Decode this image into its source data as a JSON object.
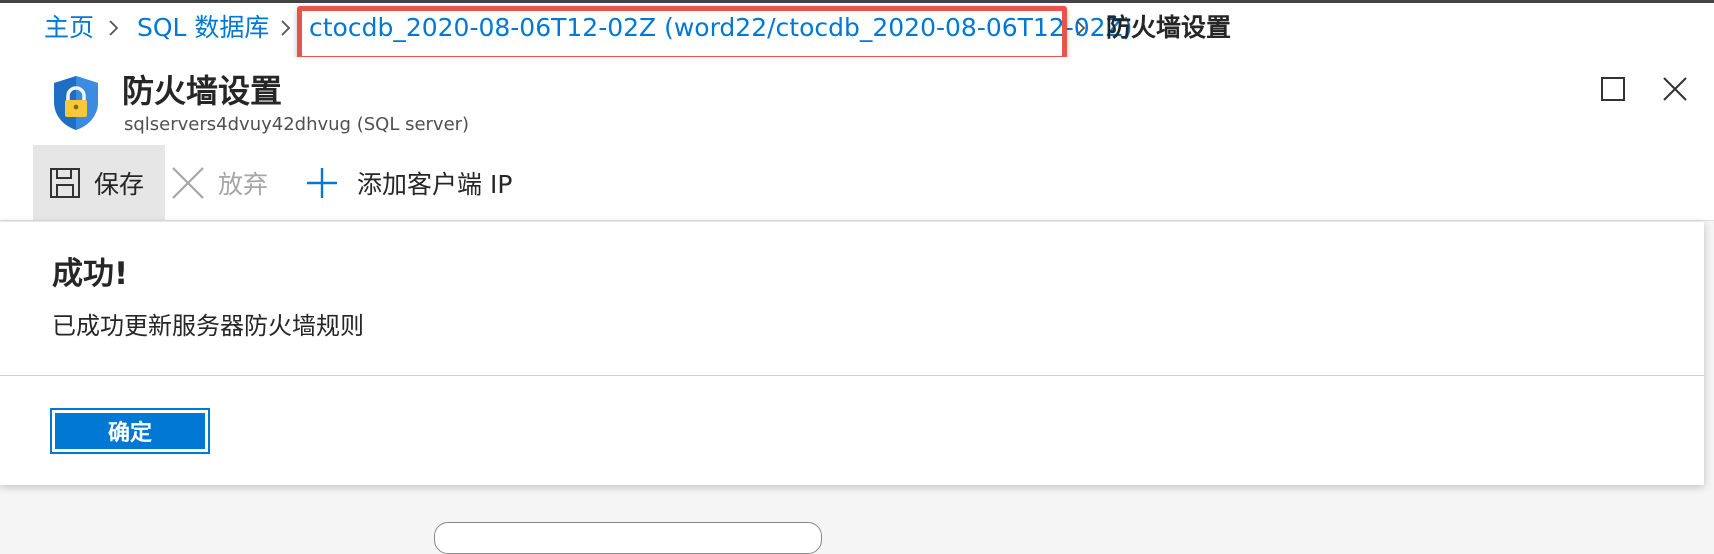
{
  "breadcrumb": {
    "home": "主页",
    "sql_databases": "SQL 数据库",
    "database": "ctocdb_2020-08-06T12-02Z (word22/ctocdb_2020-08-06T12-02Z)",
    "current": "防火墙设置"
  },
  "blade": {
    "title": "防火墙设置",
    "subtitle": "sqlservers4dvuy42dhvug (SQL server)"
  },
  "toolbar": {
    "save_label": "保存",
    "discard_label": "放弃",
    "add_client_ip_label": "添加客户端 IP"
  },
  "notification": {
    "title": "成功!",
    "message": "已成功更新服务器防火墙规则",
    "ok_label": "确定"
  },
  "colors": {
    "link": "#0078d4",
    "highlight": "#e8534a",
    "primary_button": "#0078d4"
  }
}
